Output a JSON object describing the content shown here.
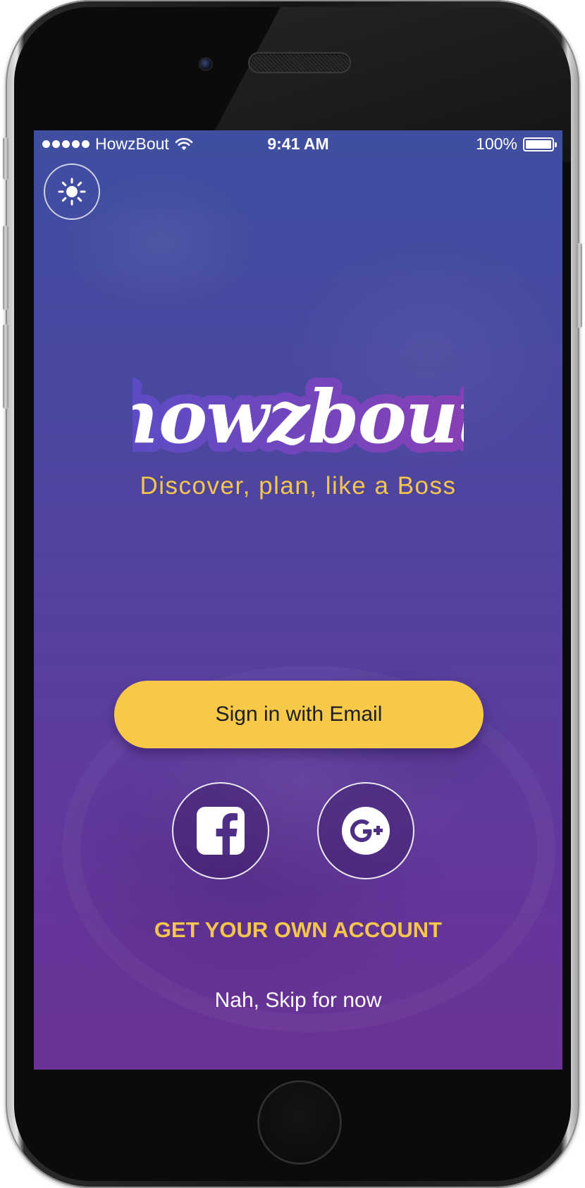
{
  "status_bar": {
    "carrier": "HowzBout",
    "time": "9:41 AM",
    "battery": "100%"
  },
  "icons": {
    "theme_toggle": "sun-icon",
    "facebook": "facebook-icon",
    "google_plus": "google-plus-icon",
    "wifi": "wifi-icon",
    "battery": "battery-icon"
  },
  "brand": {
    "logo_text": "howzbout",
    "tagline": "Discover, plan, like a Boss"
  },
  "actions": {
    "sign_in_email": "Sign in with Email",
    "create_account": "GET YOUR OWN ACCOUNT",
    "skip": "Nah, Skip for now"
  },
  "colors": {
    "accent_yellow": "#f7c948",
    "background_top": "#3f4ea0",
    "background_bottom": "#6a3294",
    "logo_outline_left": "#5a4dc6",
    "logo_outline_right": "#8a3fb4"
  }
}
